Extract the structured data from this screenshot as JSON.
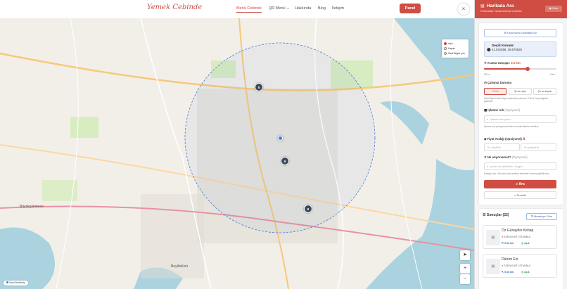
{
  "nav": {
    "logo": "Yemek Cebinde",
    "logo_tagline": "",
    "items": [
      "Menü Cebinde",
      "QR Menü",
      "Hakkında",
      "Blog",
      "İletişim"
    ],
    "panel_label": "Panel",
    "close_label": "×"
  },
  "map": {
    "legend": [
      "Açık",
      "Kapalı",
      "Saat Bilgisi yok"
    ],
    "clusters": [
      "5",
      "6",
      "9"
    ],
    "locate_label": "➤",
    "zoom_in": "+",
    "zoom_out": "−",
    "attribution": "OpenStreetMap",
    "district_labels": [
      "Büyükçekmece",
      "Beylikdüzü"
    ]
  },
  "sidebar": {
    "title": "Haritada Ara",
    "subtitle": "Restoranları harita üzerinde keşfedin",
    "hide_label": "Gizle",
    "auto_location": "Konumumu Otomatik Bul",
    "selected_location_title": "Seçili Konum:",
    "selected_location_coords": "41.041556, 28.676525",
    "radius_label": "Arama Yarıçapı:",
    "radius_value": "3.1 km",
    "radius_min": "500 m",
    "radius_max": "5 km",
    "radius_fraction": 0.6,
    "status_label": "Çalışma Durumu",
    "status_options": [
      "Tümü",
      "Şu an açık",
      "Şu an kapalı"
    ],
    "status_hint": "Saat bilgisi bulunmayan işletmeler yalnızca \"Tümü\" seçeneğinde gösterilir.",
    "business_name_label": "İşletme Adı",
    "business_name_optional": "(Opsiyonel)",
    "business_name_placeholder": "İşletme adı yazın...",
    "business_name_hint": "İşletme adı yazdığınızda liste ve harita filtrelen daraltılır.",
    "price_label": "Fiyat Aralığı (Opsiyonel)",
    "price_min_placeholder": "En düşük ₺",
    "price_max_placeholder": "En yüksek ₺",
    "query_label": "Ne arıyorsunuz?",
    "query_optional": "(Opsiyonel)",
    "query_placeholder": "pizza, en yemekleri, burger...",
    "query_hint": "Kategori adı, ürün adı veya anahtar kelimeler arama yapabilirsiniz.",
    "search_label": "Ara",
    "clear_label": "Temizle",
    "results_label": "Sonuçlar (22)",
    "sort_label": "Mesafeye Göre",
    "results": [
      {
        "name": "Öz Günaydın Kebap",
        "address": "ESENYURT, İSTANBUL",
        "distance": "0.63 km",
        "status": "Açık"
      },
      {
        "name": "Dürüm Evi",
        "address": "ESENYURT, İSTANBUL",
        "distance": "0.66 km",
        "status": "Açık"
      }
    ]
  },
  "colors": {
    "brand": "#cf4d42",
    "accent_blue": "#3a66b3",
    "open_green": "#2e8b57"
  }
}
